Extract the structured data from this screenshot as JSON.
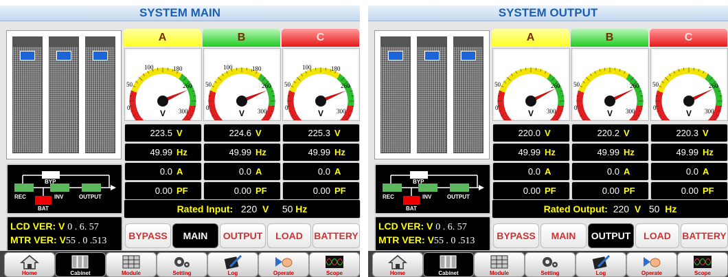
{
  "panels": [
    {
      "title": "SYSTEM MAIN",
      "phases": [
        {
          "label": "A",
          "voltage": "223.5",
          "freq": "49.99",
          "current": "0.0",
          "pf": "0.00",
          "needle": 223.5
        },
        {
          "label": "B",
          "voltage": "224.6",
          "freq": "49.99",
          "current": "0.0",
          "pf": "0.00",
          "needle": 224.6
        },
        {
          "label": "C",
          "voltage": "225.3",
          "freq": "49.99",
          "current": "0.0",
          "pf": "0.00",
          "needle": 225.3
        }
      ],
      "gauge_labels": [
        "100",
        "180",
        "50",
        "260",
        "0",
        "300",
        "V"
      ],
      "units": {
        "v": "V",
        "hz": "Hz",
        "a": "A",
        "pf": "PF"
      },
      "rated": {
        "label": "Rated Input:",
        "value": "220",
        "unit_v": "V",
        "freq": "50",
        "unit_hz": "Hz"
      },
      "lcd_label": "LCD VER:",
      "lcd_v": "V",
      "lcd_value": "0 .    6. 57",
      "mtr_label": "MTR VER:",
      "mtr_v": "V",
      "mtr_value": "55 .  0   .513",
      "tabs": [
        "BYPASS",
        "MAIN",
        "OUTPUT",
        "LOAD",
        "BATTERY"
      ],
      "active_tab": 1
    },
    {
      "title": "SYSTEM OUTPUT",
      "phases": [
        {
          "label": "A",
          "voltage": "220.0",
          "freq": "49.99",
          "current": "0.0",
          "pf": "0.00",
          "needle": 220.0
        },
        {
          "label": "B",
          "voltage": "220.2",
          "freq": "49.99",
          "current": "0.0",
          "pf": "0.00",
          "needle": 220.2
        },
        {
          "label": "C",
          "voltage": "220.3",
          "freq": "49.99",
          "current": "0.0",
          "pf": "0.00",
          "needle": 220.3
        }
      ],
      "gauge_labels": [
        "",
        "",
        "50",
        "260",
        "0",
        "300",
        "V"
      ],
      "units": {
        "v": "V",
        "hz": "Hz",
        "a": "A",
        "pf": "PF"
      },
      "rated": {
        "label": "Rated Output:",
        "value": "220",
        "unit_v": "V",
        "freq": "50",
        "unit_hz": "Hz"
      },
      "lcd_label": "LCD VER:",
      "lcd_v": "V",
      "lcd_value": "0 .    6. 57",
      "mtr_label": "MTR VER:",
      "mtr_v": "V",
      "mtr_value": "55 . 0   .513",
      "tabs": [
        "BYPASS",
        "MAIN",
        "OUTPUT",
        "LOAD",
        "BATTERY"
      ],
      "active_tab": 2
    }
  ],
  "flow_labels": {
    "byp": "BYP",
    "rec": "REC",
    "inv": "INV",
    "output": "OUTPUT",
    "bat": "BAT"
  },
  "nav_items": [
    "Home",
    "Cabinet",
    "Module",
    "Setting",
    "Log",
    "Operate",
    "Scope"
  ],
  "active_nav": 1,
  "colors": {
    "header_text": "#1a5fb4",
    "phase_a": "#ffff33",
    "phase_b": "#33dd33",
    "phase_c": "#ee2222",
    "unit_yellow": "#ffff00",
    "tab_red": "#cc3333"
  }
}
